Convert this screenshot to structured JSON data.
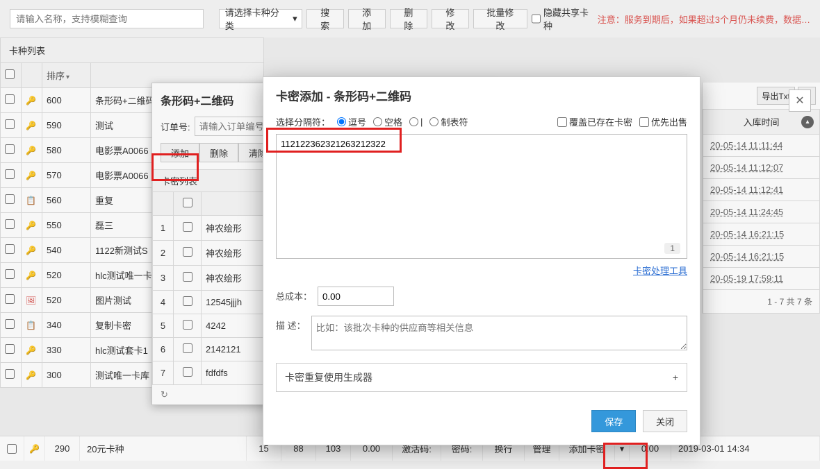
{
  "toolbar": {
    "search_placeholder": "请输入名称，支持模糊查询",
    "category_placeholder": "请选择卡种分类",
    "btn_search": "搜索",
    "btn_add": "添加",
    "btn_delete": "删除",
    "btn_modify": "修改",
    "btn_batch": "批量修改",
    "chk_hide_shared": "隐藏共享卡种",
    "warn": "注意：服务到期后，如果超过3个月仍未续费，数据…"
  },
  "left": {
    "title": "卡种列表",
    "col_sort": "排序",
    "rows": [
      {
        "sort": "600",
        "name": "条形码+二维码",
        "icon": "key"
      },
      {
        "sort": "590",
        "name": "测试",
        "icon": "key"
      },
      {
        "sort": "580",
        "name": "电影票A0066",
        "icon": "key"
      },
      {
        "sort": "570",
        "name": "电影票A0066",
        "icon": "key"
      },
      {
        "sort": "560",
        "name": "重复",
        "icon": "copy"
      },
      {
        "sort": "550",
        "name": "磊三",
        "icon": "key"
      },
      {
        "sort": "540",
        "name": "1122新测试S",
        "icon": "key"
      },
      {
        "sort": "520",
        "name": "hlc测试唯一卡",
        "icon": "key"
      },
      {
        "sort": "520",
        "name": "图片测试",
        "icon": "img"
      },
      {
        "sort": "340",
        "name": "复制卡密",
        "icon": "copy"
      },
      {
        "sort": "330",
        "name": "hlc测试套卡1",
        "icon": "key"
      },
      {
        "sort": "300",
        "name": "测试唯一卡库",
        "icon": "key"
      },
      {
        "sort": "290",
        "name": "20元卡种",
        "icon": "key"
      }
    ]
  },
  "panel": {
    "title": "条形码+二维码",
    "order_label": "订单号:",
    "order_placeholder": "请输入订单编号",
    "btn_add": "添加",
    "btn_delete": "删除",
    "btn_clear": "清除",
    "km_list_title": "卡密列表",
    "rows": [
      {
        "n": "1",
        "v": "神农绘形"
      },
      {
        "n": "2",
        "v": "神农绘形"
      },
      {
        "n": "3",
        "v": "神农绘形"
      },
      {
        "n": "4",
        "v": "12545jjjh"
      },
      {
        "n": "5",
        "v": "4242"
      },
      {
        "n": "6",
        "v": "2142121"
      },
      {
        "n": "7",
        "v": "fdfdfs"
      }
    ]
  },
  "modal": {
    "title": "卡密添加 - 条形码+二维码",
    "sep_label": "选择分隔符：",
    "sep_comma": "逗号",
    "sep_space": "空格",
    "sep_pipe": "|",
    "sep_tab": "制表符",
    "chk_overwrite": "覆盖已存在卡密",
    "chk_priority": "优先出售",
    "body_text": "112122362321263212322",
    "page_badge": "1",
    "tool_link": "卡密处理工具",
    "cost_label": "总成本：",
    "cost_value": "0.00",
    "desc_label": "描    述：",
    "desc_placeholder": "比如：该批次卡种的供应商等相关信息",
    "collapse": "卡密重复使用生成器",
    "collapse_plus": "+",
    "btn_save": "保存",
    "btn_close": "关闭"
  },
  "right": {
    "export_txt": "导出Txt",
    "more": "…",
    "col": "入库时间",
    "rows": [
      "20-05-14 11:11:44",
      "20-05-14 11:12:07",
      "20-05-14 11:12:41",
      "20-05-14 11:24:45",
      "20-05-14 16:21:15",
      "20-05-14 16:21:15",
      "20-05-19 17:59:11"
    ],
    "summary": "1 - 7   共 7 条"
  },
  "bottom": {
    "c1": "15",
    "c2": "88",
    "c3": "103",
    "c4": "0.00",
    "c5": "激活码:",
    "c6": "密码:",
    "c7": "换行",
    "c8": "管理",
    "c9": "添加卡密",
    "c10": "0.00",
    "c11": "2019-03-01 14:34"
  }
}
